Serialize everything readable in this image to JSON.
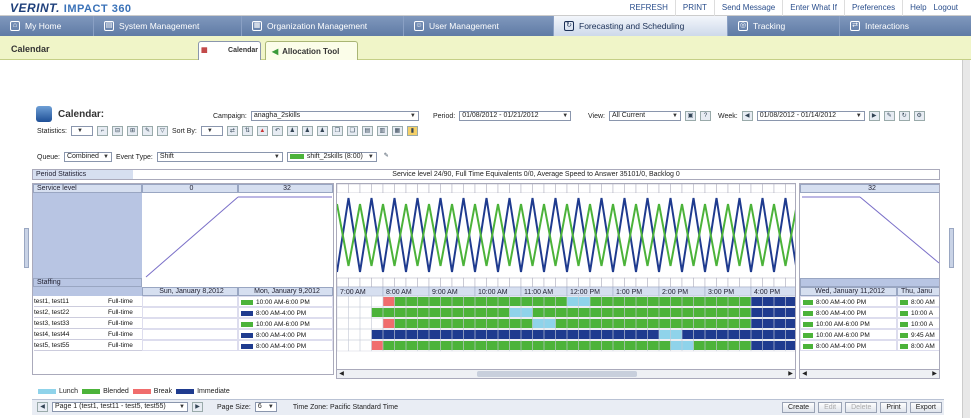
{
  "brand": {
    "name": "VERINT.",
    "product": "IMPACT 360"
  },
  "top_links": [
    "REFRESH",
    "PRINT",
    "Send Message",
    "Enter What If",
    "Preferences",
    "Help",
    "Logout"
  ],
  "nav": [
    {
      "label": "My Home",
      "icon": "home-icon"
    },
    {
      "label": "System Management",
      "icon": "system-icon"
    },
    {
      "label": "Organization Management",
      "icon": "org-icon"
    },
    {
      "label": "User Management",
      "icon": "user-icon"
    },
    {
      "label": "Forecasting and Scheduling",
      "icon": "forecast-icon",
      "active": true
    },
    {
      "label": "Tracking",
      "icon": "tracking-icon"
    },
    {
      "label": "Interactions",
      "icon": "interactions-icon"
    }
  ],
  "page_title": "Calendar",
  "subtabs": [
    {
      "label": "Calendar",
      "selected": true
    },
    {
      "label": "Allocation Tool",
      "selected": false
    }
  ],
  "calendar": {
    "title": "Calendar:",
    "campaign_label": "Campaign:",
    "campaign_value": "anagha_2skills",
    "period_label": "Period:",
    "period_value": "01/08/2012 - 01/21/2012",
    "view_label": "View:",
    "view_value": "All Current",
    "week_label": "Week:",
    "week_value": "01/08/2012 - 01/14/2012"
  },
  "statistics": {
    "label": "Statistics:",
    "sortby_label": "Sort By:"
  },
  "filters": {
    "queue_label": "Queue:",
    "queue_value": "Combined",
    "event_label": "Event Type:",
    "event_value": "Shift",
    "shift_value": "shift_2skills (8:00)"
  },
  "period_stats": {
    "label": "Period Statistics",
    "text": "Service level 24/90, Full Time Equivalents 0/0, Average Speed to Answer 35101/0, Backlog 0"
  },
  "service_level": {
    "label": "Service level",
    "left_vals": [
      "0",
      "32"
    ],
    "right_vals": [
      "32"
    ]
  },
  "staffing_label": "Staffing",
  "days": [
    "Sun, January 8,2012",
    "Mon, January 9,2012",
    "Wed, January 11,2012",
    "Thu, Janu"
  ],
  "hours": [
    "7:00 AM",
    "8:00 AM",
    "9:00 AM",
    "10:00 AM",
    "11:00 AM",
    "12:00 PM",
    "1:00 PM",
    "2:00 PM",
    "3:00 PM",
    "4:00 PM"
  ],
  "agents": [
    {
      "name": "test1, test11",
      "type": "Full-time",
      "mon": "10:00 AM-6:00 PM",
      "wed": "8:00 AM-4:00 PM",
      "thu": "8:00 AM"
    },
    {
      "name": "test2, test22",
      "type": "Full-time",
      "mon": "8:00 AM-4:00 PM",
      "wed": "8:00 AM-4:00 PM",
      "thu": "10:00 A"
    },
    {
      "name": "test3, test33",
      "type": "Full-time",
      "mon": "10:00 AM-6:00 PM",
      "wed": "10:00 AM-6:00 PM",
      "thu": "10:00 A"
    },
    {
      "name": "test4, test44",
      "type": "Full-time",
      "mon": "8:00 AM-4:00 PM",
      "wed": "10:00 AM-6:00 PM",
      "thu": "9:45 AM"
    },
    {
      "name": "test5, test55",
      "type": "Full-time",
      "mon": "8:00 AM-4:00 PM",
      "wed": "8:00 AM-4:00 PM",
      "thu": "8:00 AM"
    }
  ],
  "legend": [
    {
      "label": "Lunch",
      "color": "#8fd3ea"
    },
    {
      "label": "Blended",
      "color": "#4cb33a"
    },
    {
      "label": "Break",
      "color": "#f06d6d"
    },
    {
      "label": "Immediate",
      "color": "#1f3b8f"
    }
  ],
  "footer": {
    "page_value": "Page 1 (test1, test11 - test5, test55)",
    "pagesize_label": "Page Size:",
    "pagesize_value": "6",
    "timezone": "Time Zone: Pacific Standard Time",
    "buttons": [
      "Create",
      "Edit",
      "Delete",
      "Print",
      "Export"
    ]
  },
  "colors": {
    "blended": "#4cb33a",
    "immediate": "#1f3b8f",
    "lunch": "#8fd3ea",
    "break": "#f06d6d"
  }
}
